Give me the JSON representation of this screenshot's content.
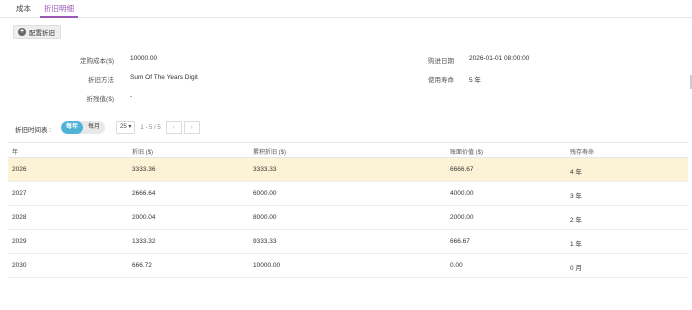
{
  "tabs": [
    {
      "label": "成本"
    },
    {
      "label": "折旧明细"
    }
  ],
  "config_button": {
    "label": "配置折旧",
    "icon": "plus-circle-icon"
  },
  "info": {
    "purchase_cost_label": "定购成本($)",
    "purchase_cost_value": "10000.00",
    "method_label": "折旧方法",
    "method_value": "Sum Of The Years Digit",
    "residual_label": "折残值($)",
    "residual_value": "-",
    "purchase_date_label": "购进日期",
    "purchase_date_value": "2026-01-01 08:00:00",
    "life_label": "使用寿命",
    "life_value": "5 年"
  },
  "schedule": {
    "label": "折旧时间表 :",
    "toggle": [
      {
        "label": "每年",
        "active": true
      },
      {
        "label": "每月",
        "active": false
      }
    ],
    "page_size": "25 ▾",
    "range": "1 - 5 / 5",
    "prev": "‹",
    "next": "›"
  },
  "table": {
    "headers": [
      "年",
      "折旧 ($)",
      "累积折旧 ($)",
      "账面价值 ($)",
      "残存寿命"
    ],
    "rows": [
      [
        "2026",
        "3333.36",
        "3333.33",
        "6666.67",
        "4 年"
      ],
      [
        "2027",
        "2666.64",
        "6000.00",
        "4000.00",
        "3 年"
      ],
      [
        "2028",
        "2000.04",
        "8000.00",
        "2000.00",
        "2 年"
      ],
      [
        "2029",
        "1333.32",
        "9333.33",
        "666.67",
        "1 年"
      ],
      [
        "2030",
        "666.72",
        "10000.00",
        "0.00",
        "0 月"
      ]
    ]
  },
  "colors": {
    "accent": "#9b59b6",
    "toggle_active": "#4fb3d8",
    "row_highlight": "#fcf3d6"
  }
}
